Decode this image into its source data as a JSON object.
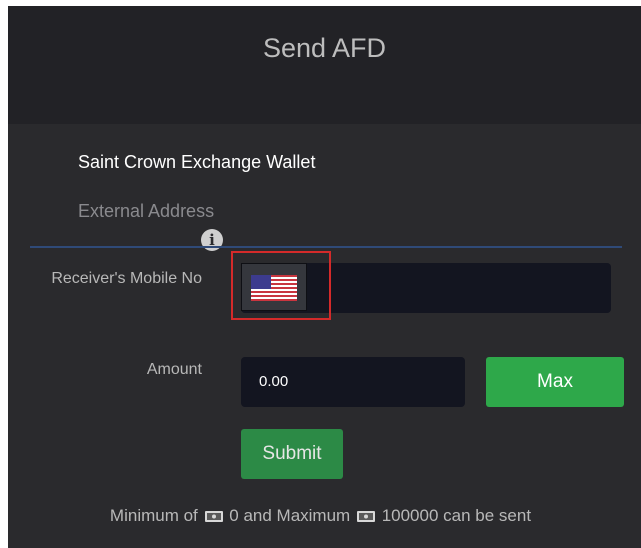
{
  "modal": {
    "title": "Send AFD"
  },
  "tabs": {
    "wallet_label": "Saint Crown Exchange Wallet",
    "external_label": "External Address",
    "info_icon": "info-circle-icon"
  },
  "form": {
    "receiver_mobile_label": "Receiver's Mobile No",
    "country_flag": "us-flag-icon",
    "phone_value": "",
    "amount_label": "Amount",
    "amount_value": "0.00",
    "max_label": "Max",
    "submit_label": "Submit"
  },
  "limits": {
    "prefix": "Minimum of",
    "min_value": "0",
    "middle": "and Maximum",
    "max_value": "100000",
    "suffix": "can be sent",
    "currency_icon": "currency-icon"
  },
  "colors": {
    "accent_green": "#2ea84a",
    "submit_green": "#2c8a46",
    "highlight_red": "#d42a2a",
    "tab_underline": "#2f4a78"
  }
}
